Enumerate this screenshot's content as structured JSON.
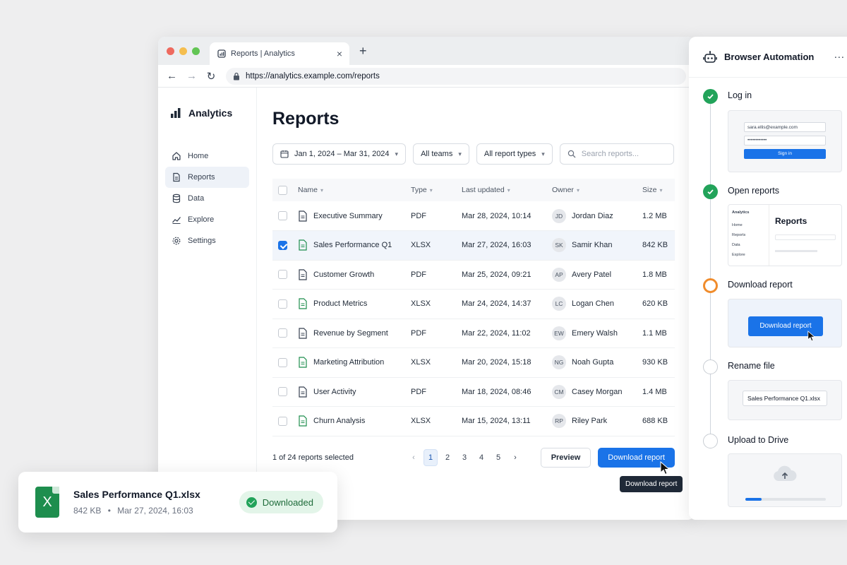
{
  "browser": {
    "tab_title": "Reports | Analytics",
    "tab_close": "×",
    "new_tab": "+",
    "url": "https://analytics.example.com/reports",
    "traffic_colors": [
      "#ee6a5f",
      "#f5be4f",
      "#62c554"
    ]
  },
  "sidebar": {
    "brand": "Analytics",
    "items": [
      {
        "label": "Home",
        "icon": "home-icon",
        "active": false
      },
      {
        "label": "Reports",
        "icon": "file-icon",
        "active": true
      },
      {
        "label": "Data",
        "icon": "database-icon",
        "active": false
      },
      {
        "label": "Explore",
        "icon": "trend-icon",
        "active": false
      },
      {
        "label": "Settings",
        "icon": "gear-icon",
        "active": false
      }
    ]
  },
  "main": {
    "title": "Reports",
    "filters": {
      "date": "Jan 1, 2024 – Mar 31, 2024",
      "teams": "All teams",
      "types": "All report types",
      "search_placeholder": "Search reports..."
    },
    "columns": [
      "Name",
      "Type",
      "Last updated",
      "Owner",
      "Size"
    ],
    "rows": [
      {
        "name": "Executive Summary",
        "type": "PDF",
        "updated": "Mar 28, 2024, 10:14",
        "initials": "JD",
        "owner": "Jordan Diaz",
        "size": "1.2 MB",
        "selected": false
      },
      {
        "name": "Sales Performance Q1",
        "type": "XLSX",
        "updated": "Mar 27, 2024, 16:03",
        "initials": "SK",
        "owner": "Samir Khan",
        "size": "842 KB",
        "selected": true
      },
      {
        "name": "Customer Growth",
        "type": "PDF",
        "updated": "Mar 25, 2024, 09:21",
        "initials": "AP",
        "owner": "Avery Patel",
        "size": "1.8 MB",
        "selected": false
      },
      {
        "name": "Product Metrics",
        "type": "XLSX",
        "updated": "Mar 24, 2024, 14:37",
        "initials": "LC",
        "owner": "Logan Chen",
        "size": "620 KB",
        "selected": false
      },
      {
        "name": "Revenue by Segment",
        "type": "PDF",
        "updated": "Mar 22, 2024, 11:02",
        "initials": "EW",
        "owner": "Emery Walsh",
        "size": "1.1 MB",
        "selected": false
      },
      {
        "name": "Marketing Attribution",
        "type": "XLSX",
        "updated": "Mar 20, 2024, 15:18",
        "initials": "NG",
        "owner": "Noah Gupta",
        "size": "930 KB",
        "selected": false
      },
      {
        "name": "User Activity",
        "type": "PDF",
        "updated": "Mar 18, 2024, 08:46",
        "initials": "CM",
        "owner": "Casey Morgan",
        "size": "1.4 MB",
        "selected": false
      },
      {
        "name": "Churn Analysis",
        "type": "XLSX",
        "updated": "Mar 15, 2024, 13:11",
        "initials": "RP",
        "owner": "Riley Park",
        "size": "688 KB",
        "selected": false
      }
    ],
    "selection_text": "1 of 24 reports selected",
    "pages": [
      "1",
      "2",
      "3",
      "4",
      "5"
    ],
    "current_page": "1",
    "preview_label": "Preview",
    "download_label": "Download report",
    "tooltip": "Download report"
  },
  "automation": {
    "title": "Browser Automation",
    "more": "···",
    "steps": [
      {
        "label": "Log in",
        "status": "done"
      },
      {
        "label": "Open reports",
        "status": "done"
      },
      {
        "label": "Download report",
        "status": "current"
      },
      {
        "label": "Rename file",
        "status": "todo"
      },
      {
        "label": "Upload to Drive",
        "status": "todo"
      }
    ],
    "login_email": "sara.ellis@example.com",
    "login_password": "••••••••••••",
    "login_button": "Sign in",
    "mini_brand": "Analytics",
    "mini_title": "Reports",
    "mini_nav": [
      "Home",
      "Reports",
      "Data",
      "Explore"
    ],
    "download_button": "Download report",
    "rename_value": "Sales Performance Q1.xlsx",
    "upload_progress": 0.2
  },
  "toast": {
    "filename": "Sales Performance Q1.xlsx",
    "size": "842 KB",
    "separator": "•",
    "date": "Mar 27, 2024, 16:03",
    "status": "Downloaded",
    "file_letter": "X"
  },
  "colors": {
    "accent": "#1a73e8",
    "success": "#22a35a",
    "in_progress": "#f08c2c",
    "excel_green": "#1e8e4e"
  }
}
